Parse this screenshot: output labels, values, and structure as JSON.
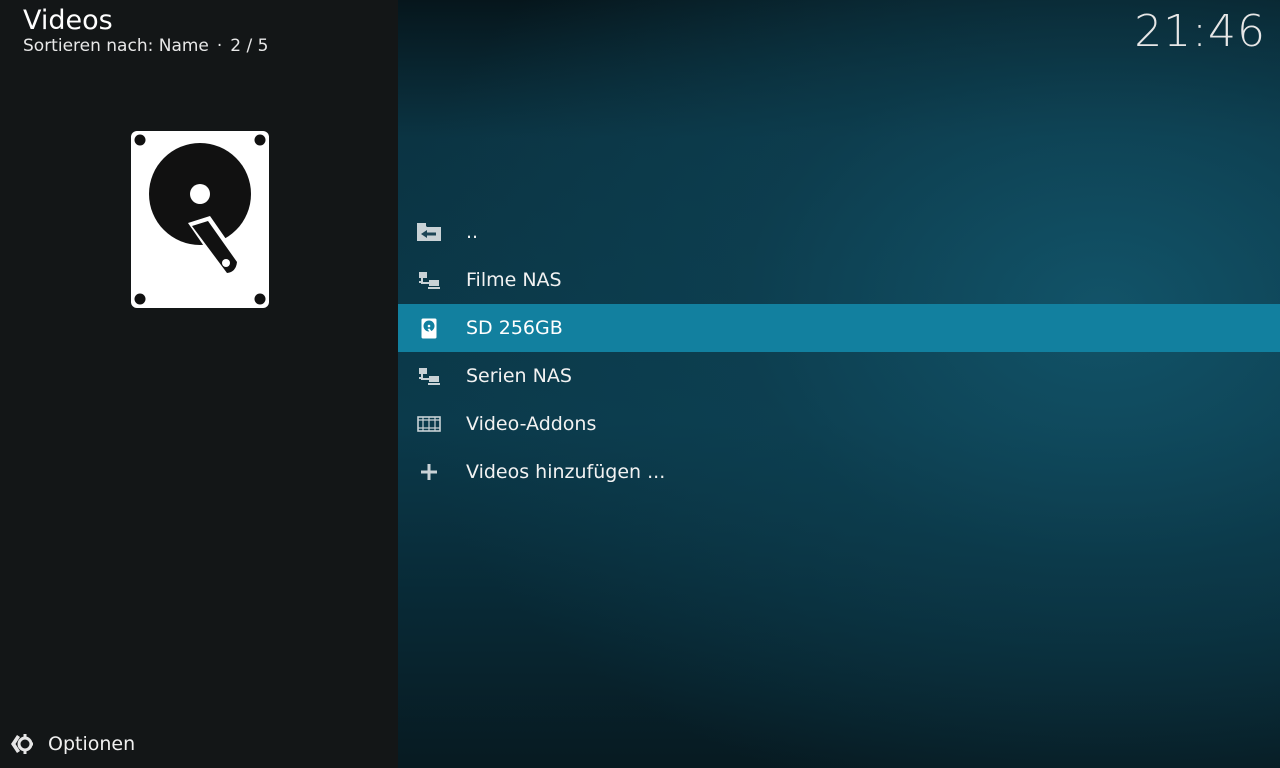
{
  "header": {
    "title": "Videos",
    "sort_label": "Sortieren nach: Name",
    "separator": "·",
    "position": "2 / 5"
  },
  "clock": "21:46",
  "thumbnail": {
    "icon": "hard-drive-icon"
  },
  "list": {
    "items": [
      {
        "label": "..",
        "icon": "folder-back-icon"
      },
      {
        "label": "Filme NAS",
        "icon": "network-icon"
      },
      {
        "label": "SD 256GB",
        "icon": "hard-drive-icon",
        "selected": true
      },
      {
        "label": "Serien NAS",
        "icon": "network-icon"
      },
      {
        "label": "Video-Addons",
        "icon": "film-strip-icon"
      },
      {
        "label": "Videos hinzufügen ...",
        "icon": "plus-icon"
      }
    ]
  },
  "footer": {
    "options_label": "Optionen",
    "icon": "options-icon"
  },
  "colors": {
    "accent": "#12809f",
    "sidebar_bg": "#131617",
    "main_bg": "#0b3a4b"
  }
}
